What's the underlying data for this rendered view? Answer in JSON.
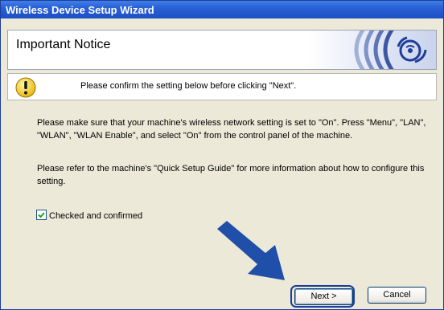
{
  "window": {
    "title": "Wireless Device Setup Wizard"
  },
  "header": {
    "title": "Important Notice"
  },
  "notice": {
    "text": "Please confirm the setting below before clicking \"Next\"."
  },
  "body": {
    "paragraph1": "Please make sure that your machine's wireless network setting is set to \"On\". Press \"Menu\", \"LAN\", \"WLAN\", \"WLAN Enable\", and select \"On\" from the control panel of the machine.",
    "paragraph2": "Please refer to the machine's \"Quick Setup Guide\" for more information about how to configure this setting."
  },
  "checkbox": {
    "label": "Checked and confirmed",
    "checked": true
  },
  "buttons": {
    "next": "Next >",
    "cancel": "Cancel"
  },
  "colors": {
    "titlebar": "#2a5fd6",
    "dialog_bg": "#ece9d8",
    "arrow": "#1f4fa8",
    "header_logo": "#1f3d9a"
  },
  "icons": {
    "warning": "warning-icon",
    "wireless_logo": "wireless-logo-icon",
    "arrow": "pointer-arrow-icon",
    "check": "check-icon"
  }
}
